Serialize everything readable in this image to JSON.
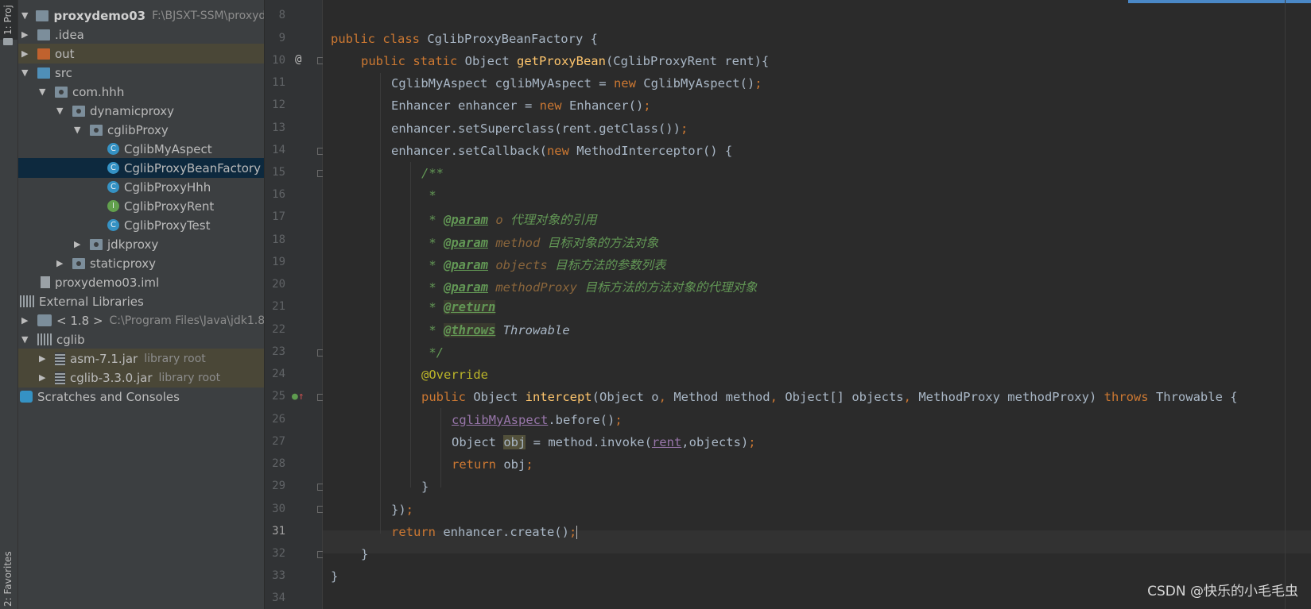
{
  "tool_stripe": {
    "top_tab": "1: Proj",
    "bottom_tab": "2: Favorites"
  },
  "tree": {
    "root": {
      "name": "proxydemo03",
      "path": "F:\\BJSXT-SSM\\proxyde"
    },
    "items": [
      {
        "label": "proxydemo03",
        "hint": "F:\\BJSXT-SSM\\proxyde"
      },
      {
        "label": ".idea"
      },
      {
        "label": "out"
      },
      {
        "label": "src"
      },
      {
        "label": "com.hhh"
      },
      {
        "label": "dynamicproxy"
      },
      {
        "label": "cglibProxy"
      },
      {
        "label": "CglibMyAspect",
        "badge": "C"
      },
      {
        "label": "CglibProxyBeanFactory",
        "badge": "C"
      },
      {
        "label": "CglibProxyHhh",
        "badge": "C"
      },
      {
        "label": "CglibProxyRent",
        "badge": "I"
      },
      {
        "label": "CglibProxyTest",
        "badge": "C"
      },
      {
        "label": "jdkproxy"
      },
      {
        "label": "staticproxy"
      },
      {
        "label": "proxydemo03.iml"
      },
      {
        "label": "External Libraries"
      },
      {
        "label": "< 1.8 >",
        "hint": "C:\\Program Files\\Java\\jdk1.8"
      },
      {
        "label": "cglib"
      },
      {
        "label": "asm-7.1.jar",
        "hint": "library root"
      },
      {
        "label": "cglib-3.3.0.jar",
        "hint": "library root"
      },
      {
        "label": "Scratches and Consoles"
      }
    ]
  },
  "line_numbers": [
    "8",
    "9",
    "10",
    "11",
    "12",
    "13",
    "14",
    "15",
    "16",
    "17",
    "18",
    "19",
    "20",
    "21",
    "22",
    "23",
    "24",
    "25",
    "26",
    "27",
    "28",
    "29",
    "30",
    "31",
    "32",
    "33",
    "34"
  ],
  "code": {
    "l9": {
      "a": "public class ",
      "b": "CglibProxyBeanFactory {"
    },
    "l10": {
      "a": "public static ",
      "b": "Object ",
      "c": "getProxyBean",
      "d": "(CglibProxyRent rent){"
    },
    "l11": {
      "a": "CglibMyAspect cglibMyAspect = ",
      "b": "new ",
      "c": "CglibMyAspect()",
      "d": ";"
    },
    "l12": {
      "a": "Enhancer enhancer = ",
      "b": "new ",
      "c": "Enhancer()",
      "d": ";"
    },
    "l13": {
      "a": "enhancer.setSuperclass(rent.getClass())",
      "b": ";"
    },
    "l14": {
      "a": "enhancer.setCallback(",
      "b": "new ",
      "c": "MethodInterceptor() {"
    },
    "l15": "/**",
    "l16": " *",
    "l17": {
      "star": " * ",
      "tag": "@param",
      "p": " o",
      "t": " 代理对象的引用"
    },
    "l18": {
      "star": " * ",
      "tag": "@param",
      "p": " method",
      "t": " 目标对象的方法对象"
    },
    "l19": {
      "star": " * ",
      "tag": "@param",
      "p": " objects",
      "t": " 目标方法的参数列表"
    },
    "l20": {
      "star": " * ",
      "tag": "@param",
      "p": " methodProxy",
      "t": " 目标方法的方法对象的代理对象"
    },
    "l21": {
      "star": " * ",
      "tag": "@return"
    },
    "l22": {
      "star": " * ",
      "tag": "@throws",
      "t": " Throwable"
    },
    "l23": " */",
    "l24": "@Override",
    "l25": {
      "a": "public ",
      "b": "Object ",
      "c": "intercept",
      "d": "(Object o",
      "e": ", ",
      "f": "Method method",
      "g": ", ",
      "h": "Object[] objects",
      "i": ", ",
      "j": "MethodProxy methodProxy) ",
      "k": "throws ",
      "l": "Throwable {"
    },
    "l26": {
      "a": "cglibMyAspect",
      "b": ".before()",
      "c": ";"
    },
    "l27": {
      "a": "Object ",
      "b": "obj",
      "c": " = method.invoke(",
      "d": "rent",
      "e": ",objects)",
      "f": ";"
    },
    "l28": {
      "a": "return ",
      "b": "obj",
      "c": ";"
    },
    "l29": "}",
    "l30": {
      "a": "})",
      "b": ";"
    },
    "l31": {
      "a": "return ",
      "b": "enhancer.create()",
      "c": ";"
    },
    "l32": "}",
    "l33": "}"
  },
  "gutter_marks": {
    "override_at": "@"
  },
  "watermark": "CSDN @快乐的小毛毛虫"
}
